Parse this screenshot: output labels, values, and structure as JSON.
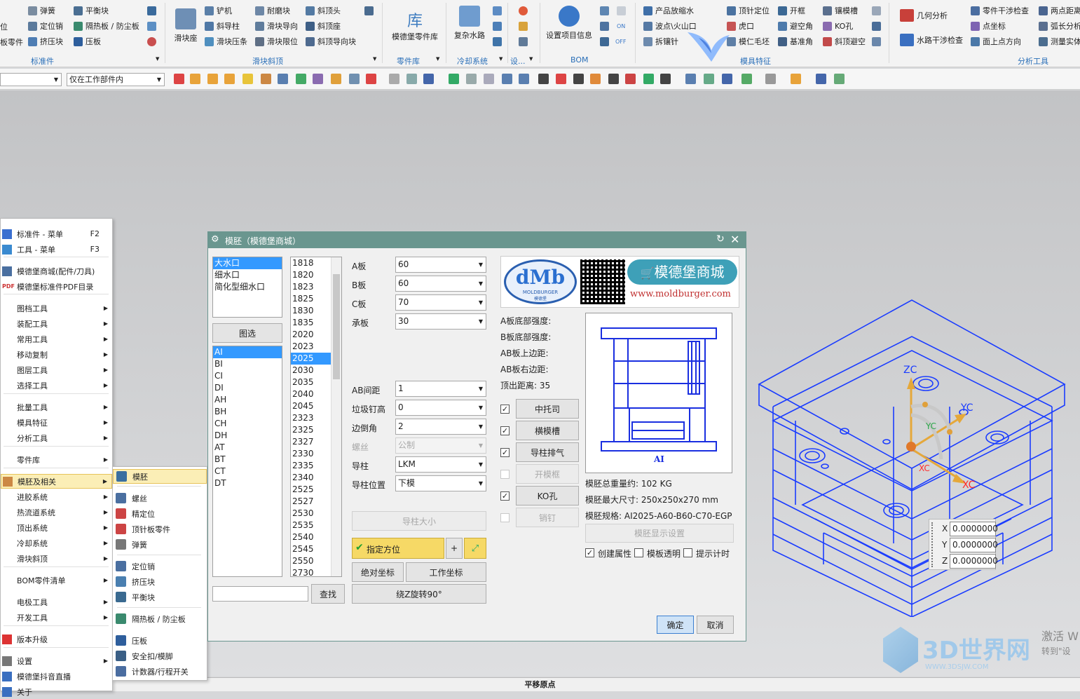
{
  "ribbon": {
    "col1": [
      "位",
      "板零件"
    ],
    "std_parts": [
      "弹簧",
      "定位销",
      "挤压块",
      "平衡块",
      "隔热板 / 防尘板",
      "压板"
    ],
    "std_group": "标准件",
    "slider": [
      "滑块座",
      "铲机",
      "斜导柱",
      "滑块压条",
      "耐磨块",
      "滑块导向",
      "滑块限位",
      "斜顶头",
      "斜顶座",
      "斜顶导向块"
    ],
    "slider_group": "滑块斜顶",
    "lib_big": "模德堡零件库",
    "lib_char": "库",
    "lib_group": "零件库",
    "cool_big": "复杂水路",
    "cool_group": "冷却系统",
    "set_group": "设...",
    "bom_big": "设置项目信息",
    "bom_group": "BOM",
    "on_label": "ON",
    "off_label": "OFF",
    "feature": [
      "产品放缩水",
      "波点\\火山口",
      "拆镶针",
      "顶针定位",
      "虎口",
      "模仁毛坯",
      "开框",
      "避空角",
      "基准角",
      "镶模槽",
      "KO孔",
      "斜顶避空"
    ],
    "feature_group": "模具特征",
    "analysis": [
      "几何分析",
      "零件干涉检查",
      "点坐标",
      "水路干涉检查",
      "面上点方向",
      "两点距离",
      "弧长分析",
      "测量实体"
    ],
    "analysis_group": "分析工具"
  },
  "toolbar": {
    "filter_value": "仅在工作部件内"
  },
  "menu": {
    "items": [
      {
        "label": "标准件 - 菜单",
        "shortcut": "F2"
      },
      {
        "label": "工具 - 菜单",
        "shortcut": "F3"
      },
      {
        "label": "模德堡商城(配件/刀具)"
      },
      {
        "label": "模德堡标准件PDF目录"
      },
      {
        "label": "图档工具"
      },
      {
        "label": "装配工具"
      },
      {
        "label": "常用工具"
      },
      {
        "label": "移动复制"
      },
      {
        "label": "图层工具"
      },
      {
        "label": "选择工具"
      },
      {
        "label": "批量工具"
      },
      {
        "label": "模具特征"
      },
      {
        "label": "分析工具"
      },
      {
        "label": "零件库"
      },
      {
        "label": "模胚及相关"
      },
      {
        "label": "进胶系统"
      },
      {
        "label": "热流道系统"
      },
      {
        "label": "顶出系统"
      },
      {
        "label": "冷却系统"
      },
      {
        "label": "滑块斜顶"
      },
      {
        "label": "BOM零件清单"
      },
      {
        "label": "电极工具"
      },
      {
        "label": "开发工具"
      },
      {
        "label": "版本升级"
      },
      {
        "label": "设置"
      },
      {
        "label": "模德堡抖音直播"
      },
      {
        "label": "关于"
      }
    ],
    "pdf_tag": "PDF"
  },
  "submenu": {
    "items": [
      "模胚",
      "螺丝",
      "精定位",
      "顶针板零件",
      "弹簧",
      "定位销",
      "挤压块",
      "平衡块",
      "隔热板 / 防尘板",
      "压板",
      "安全扣/模脚",
      "计数器/行程开关"
    ]
  },
  "dialog": {
    "title": "模胚（模德堡商城）",
    "gate_types": [
      "大水口",
      "细水口",
      "简化型细水口"
    ],
    "filter_btn": "图选",
    "mold_types": [
      "AI",
      "BI",
      "CI",
      "DI",
      "AH",
      "BH",
      "CH",
      "DH",
      "AT",
      "BT",
      "CT",
      "DT"
    ],
    "sizes": [
      "1818",
      "1820",
      "1823",
      "1825",
      "1830",
      "1835",
      "2020",
      "2023",
      "2025",
      "2030",
      "2035",
      "2040",
      "2045",
      "2323",
      "2325",
      "2327",
      "2330",
      "2335",
      "2340",
      "2525",
      "2527",
      "2530",
      "2535",
      "2540",
      "2545",
      "2550",
      "2730"
    ],
    "search_btn": "查找",
    "fields": [
      {
        "label": "A板",
        "value": "60"
      },
      {
        "label": "B板",
        "value": "60"
      },
      {
        "label": "C板",
        "value": "70"
      },
      {
        "label": "承板",
        "value": "30"
      }
    ],
    "fields2": [
      {
        "label": "AB间距",
        "value": "1"
      },
      {
        "label": "垃圾钉高",
        "value": "0"
      },
      {
        "label": "边倒角",
        "value": "2"
      },
      {
        "label": "螺丝",
        "value": "公制"
      },
      {
        "label": "导柱",
        "value": "LKM"
      },
      {
        "label": "导柱位置",
        "value": "下模"
      }
    ],
    "guide_size_btn": "导柱大小",
    "specify_btn": "指定方位",
    "abs_btn": "绝对坐标",
    "work_btn": "工作坐标",
    "rotate_btn": "绕Z旋转90°",
    "strength": [
      "A板底部强度:",
      "B板底部强度:",
      "AB板上边距:",
      "AB板右边距:",
      "顶出距离: 35"
    ],
    "options": [
      {
        "label": "中托司",
        "checked": true,
        "enabled": true
      },
      {
        "label": "横模槽",
        "checked": true,
        "enabled": true
      },
      {
        "label": "导柱排气",
        "checked": true,
        "enabled": true
      },
      {
        "label": "开模框",
        "checked": false,
        "enabled": false
      },
      {
        "label": "KO孔",
        "checked": true,
        "enabled": true
      },
      {
        "label": "销钉",
        "checked": false,
        "enabled": false
      }
    ],
    "preview_label": "AI",
    "weight": "模胚总重量约: 102 KG",
    "size": "模胚最大尺寸: 250x250x270 mm",
    "spec": "模胚规格: AI2025-A60-B60-C70-EGP",
    "display_btn": "模胚显示设置",
    "bottom_checks": [
      {
        "label": "创建属性",
        "checked": true
      },
      {
        "label": "模板透明",
        "checked": false
      },
      {
        "label": "提示计时",
        "checked": false
      }
    ],
    "ok": "确定",
    "cancel": "取消",
    "logo_text": "dMb",
    "logo_sub": "MOLDBURGER",
    "logo_sub2": "模德堡",
    "shop_text": "模德堡商城",
    "shop_url": "www.moldburger.com"
  },
  "axes": {
    "zc": "ZC",
    "yc": "YC",
    "xc": "XC",
    "xc2": "XC",
    "yc2": "YC"
  },
  "coords": [
    {
      "label": "X",
      "value": "0.0000000"
    },
    {
      "label": "Y",
      "value": "0.0000000"
    },
    {
      "label": "Z",
      "value": "0.0000000"
    }
  ],
  "status": "平移原点",
  "watermark": {
    "brand": "3D世界网",
    "url": "WWW.3DSJW.COM",
    "activate": "激活 W",
    "activate2": "转到\"设"
  },
  "colors": {
    "accent": "#6a968f",
    "select": "#3399ff",
    "wire": "#1a3cff",
    "yellow": "#f6d966"
  }
}
